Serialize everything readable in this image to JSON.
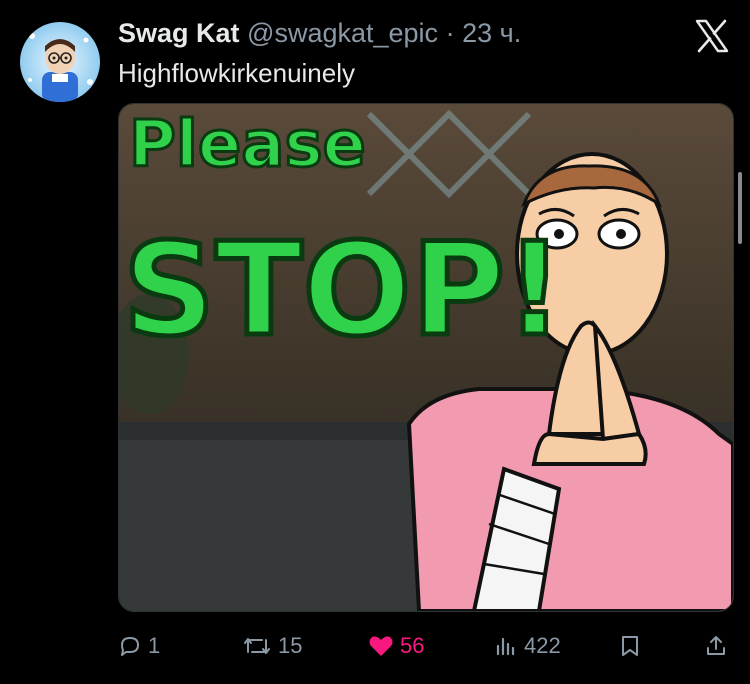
{
  "tweet": {
    "display_name": "Swag Kat",
    "handle": "@swagkat_epic",
    "separator": "·",
    "time": "23 ч.",
    "text": "Highflowkirkenuinely"
  },
  "media": {
    "caption_line1": "Please",
    "caption_line2": "STOP!",
    "caption_color": "#2fd24a"
  },
  "actions": {
    "reply_count": "1",
    "retweet_count": "15",
    "like_count": "56",
    "views_count": "422"
  },
  "icons": [
    "x-logo-icon",
    "reply-icon",
    "retweet-icon",
    "heart-icon",
    "views-icon",
    "bookmark-icon",
    "share-icon"
  ],
  "colors": {
    "background": "#000000",
    "muted": "#8b98a5",
    "like": "#f91880",
    "text": "#e7e9ea"
  }
}
